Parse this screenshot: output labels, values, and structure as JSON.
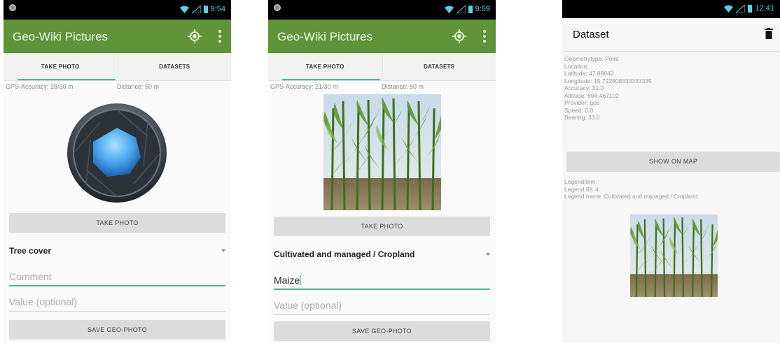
{
  "status_bars": [
    {
      "time": "9:54"
    },
    {
      "time": "9:59"
    },
    {
      "time": "12:41"
    }
  ],
  "app": {
    "title": "Geo-Wiki Pictures",
    "tabs": [
      "TAKE PHOTO",
      "DATASETS"
    ],
    "icons": {
      "location": "gps-locate-icon",
      "overflow": "more-vert-icon"
    }
  },
  "screen1": {
    "gps_accuracy": "GPS-Accuracy: 28/30 m",
    "distance": "Distance: 50 m",
    "take_photo_label": "TAKE PHOTO",
    "category": "Tree cover",
    "comment_placeholder": "Comment",
    "value_placeholder": "Value (optional)",
    "save_label": "SAVE GEO-PHOTO"
  },
  "screen2": {
    "gps_accuracy": "GPS-Accuracy: 21/30 m",
    "distance": "Distance: 50 m",
    "take_photo_label": "TAKE PHOTO",
    "category": "Cultivated and managed / Cropland",
    "comment_value": "Maize",
    "value_placeholder": "Value (optional)",
    "save_label": "SAVE GEO-PHOTO"
  },
  "screen3": {
    "title": "Dataset",
    "location_lines": [
      "Geometrytype: Point",
      "Location:",
      "Latitude: 47.88642",
      "Longitude: 15.722808333333335",
      "Accuracy: 21.0",
      "Altitude: 694.467102",
      "Provider: gps",
      "Speed: 0.0",
      "Bearing: 33.0"
    ],
    "show_on_map_label": "SHOW ON MAP",
    "legend_lines": [
      "Legenditem:",
      "Legend ID: 4",
      "Legend name: Cultivated and managed / Cropland"
    ]
  },
  "colors": {
    "appbar": "#5f9438",
    "accent": "#4bb59f",
    "statusbar": "#000000"
  }
}
